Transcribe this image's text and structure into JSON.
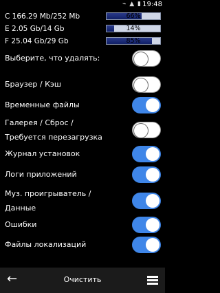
{
  "status": {
    "time": "19:48",
    "icons": "⌁ ▲ ▮"
  },
  "storage": [
    {
      "label": "C 166.29 Mb/252 Mb",
      "percent_text": "66%",
      "percent": 66
    },
    {
      "label": "E 2.05 Gb/14 Gb",
      "percent_text": "14%",
      "percent": 14
    },
    {
      "label": "F 25.04 Gb/29 Gb",
      "percent_text": "85%",
      "percent": 85
    }
  ],
  "items": [
    {
      "line1": "Выберите, что удалять:",
      "line2": "",
      "on": false
    },
    {
      "line1": "Браузер / Кэш",
      "line2": "",
      "on": false
    },
    {
      "line1": "Временные файлы",
      "line2": "",
      "on": true
    },
    {
      "line1": "Галерея / Сброс /",
      "line2": "Требуется перезагрузка",
      "on": false
    },
    {
      "line1": "Журнал установок",
      "line2": "",
      "on": true
    },
    {
      "line1": "Логи приложений",
      "line2": "",
      "on": true
    },
    {
      "line1": "Муз. проигрыватель /",
      "line2": "Данные",
      "on": true
    },
    {
      "line1": "Ошибки",
      "line2": "",
      "on": true
    },
    {
      "line1": "Файлы локализаций",
      "line2": "",
      "on": true
    }
  ],
  "bottom": {
    "clear_label": "Очистить",
    "back_icon": "left-arrow-icon",
    "menu_icon": "hamburger-menu-icon"
  }
}
